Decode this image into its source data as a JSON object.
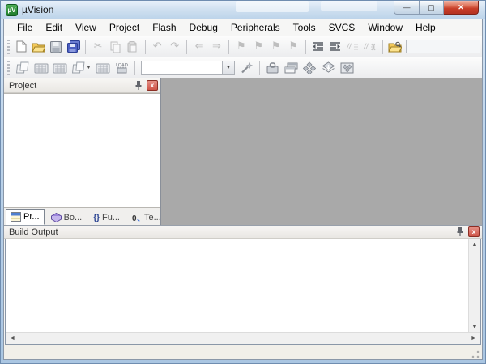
{
  "window": {
    "title": "µVision",
    "controls": {
      "minimize": "—",
      "maximize": "▢",
      "close": "✕"
    }
  },
  "menu": {
    "items": [
      "File",
      "Edit",
      "View",
      "Project",
      "Flash",
      "Debug",
      "Peripherals",
      "Tools",
      "SVCS",
      "Window",
      "Help"
    ]
  },
  "toolbar_row1": {
    "items": [
      {
        "type": "grip",
        "name": "toolbar1-grip"
      },
      {
        "type": "icon",
        "name": "new-file-icon",
        "enabled": true
      },
      {
        "type": "icon",
        "name": "open-file-icon",
        "enabled": true
      },
      {
        "type": "icon",
        "name": "save-icon",
        "enabled": true
      },
      {
        "type": "icon",
        "name": "save-all-icon",
        "enabled": true
      },
      {
        "type": "separator"
      },
      {
        "type": "icon",
        "name": "cut-icon",
        "enabled": false
      },
      {
        "type": "icon",
        "name": "copy-icon",
        "enabled": false
      },
      {
        "type": "icon",
        "name": "paste-icon",
        "enabled": false
      },
      {
        "type": "separator"
      },
      {
        "type": "icon",
        "name": "undo-icon",
        "enabled": false
      },
      {
        "type": "icon",
        "name": "redo-icon",
        "enabled": false
      },
      {
        "type": "separator"
      },
      {
        "type": "icon",
        "name": "navigate-back-icon",
        "enabled": false
      },
      {
        "type": "icon",
        "name": "navigate-forward-icon",
        "enabled": false
      },
      {
        "type": "separator"
      },
      {
        "type": "icon",
        "name": "bookmark-toggle-icon",
        "enabled": false
      },
      {
        "type": "icon",
        "name": "bookmark-previous-icon",
        "enabled": false
      },
      {
        "type": "icon",
        "name": "bookmark-next-icon",
        "enabled": false
      },
      {
        "type": "icon",
        "name": "bookmark-clear-icon",
        "enabled": false
      },
      {
        "type": "separator"
      },
      {
        "type": "icon",
        "name": "indent-decrease-icon",
        "enabled": true
      },
      {
        "type": "icon",
        "name": "indent-increase-icon",
        "enabled": true
      },
      {
        "type": "icon",
        "name": "comment-icon",
        "enabled": false
      },
      {
        "type": "icon",
        "name": "uncomment-icon",
        "enabled": false
      },
      {
        "type": "separator"
      },
      {
        "type": "icon",
        "name": "find-in-files-icon",
        "enabled": true
      },
      {
        "type": "input",
        "name": "search-input",
        "value": "",
        "placeholder": ""
      }
    ]
  },
  "toolbar_row2": {
    "download_label": "LOAD",
    "items": [
      {
        "type": "grip",
        "name": "toolbar2-grip"
      },
      {
        "type": "icon",
        "name": "translate-icon",
        "enabled": true
      },
      {
        "type": "icon",
        "name": "build-icon",
        "enabled": true
      },
      {
        "type": "icon",
        "name": "rebuild-icon",
        "enabled": true
      },
      {
        "type": "icon",
        "name": "batch-build-icon",
        "enabled": true,
        "dropdown": true
      },
      {
        "type": "icon",
        "name": "batch-setup-icon",
        "enabled": true
      },
      {
        "type": "icon",
        "name": "download-icon",
        "enabled": true
      },
      {
        "type": "separator"
      },
      {
        "type": "combo",
        "name": "target-select",
        "value": ""
      },
      {
        "type": "icon",
        "name": "options-for-target-icon",
        "enabled": true
      },
      {
        "type": "separator"
      },
      {
        "type": "icon",
        "name": "manage-project-items-icon",
        "enabled": true
      },
      {
        "type": "icon",
        "name": "file-extensions-icon",
        "enabled": true
      },
      {
        "type": "icon",
        "name": "select-software-packs-icon",
        "enabled": true
      },
      {
        "type": "icon",
        "name": "pack-installer-icon",
        "enabled": true
      },
      {
        "type": "icon",
        "name": "manage-rte-icon",
        "enabled": true
      }
    ]
  },
  "project_panel": {
    "title": "Project",
    "tabs": [
      {
        "name": "tab-project",
        "icon": "project-tab-icon",
        "label": "Pr...",
        "active": true
      },
      {
        "name": "tab-books",
        "icon": "books-tab-icon",
        "label": "Bo...",
        "active": false
      },
      {
        "name": "tab-functions",
        "icon": "functions-tab-icon",
        "label": "Fu...",
        "active": false
      },
      {
        "name": "tab-templates",
        "icon": "templates-tab-icon",
        "label": "Te...",
        "active": false
      }
    ]
  },
  "build_output": {
    "title": "Build Output",
    "content": ""
  },
  "status_bar": {
    "text": ""
  }
}
